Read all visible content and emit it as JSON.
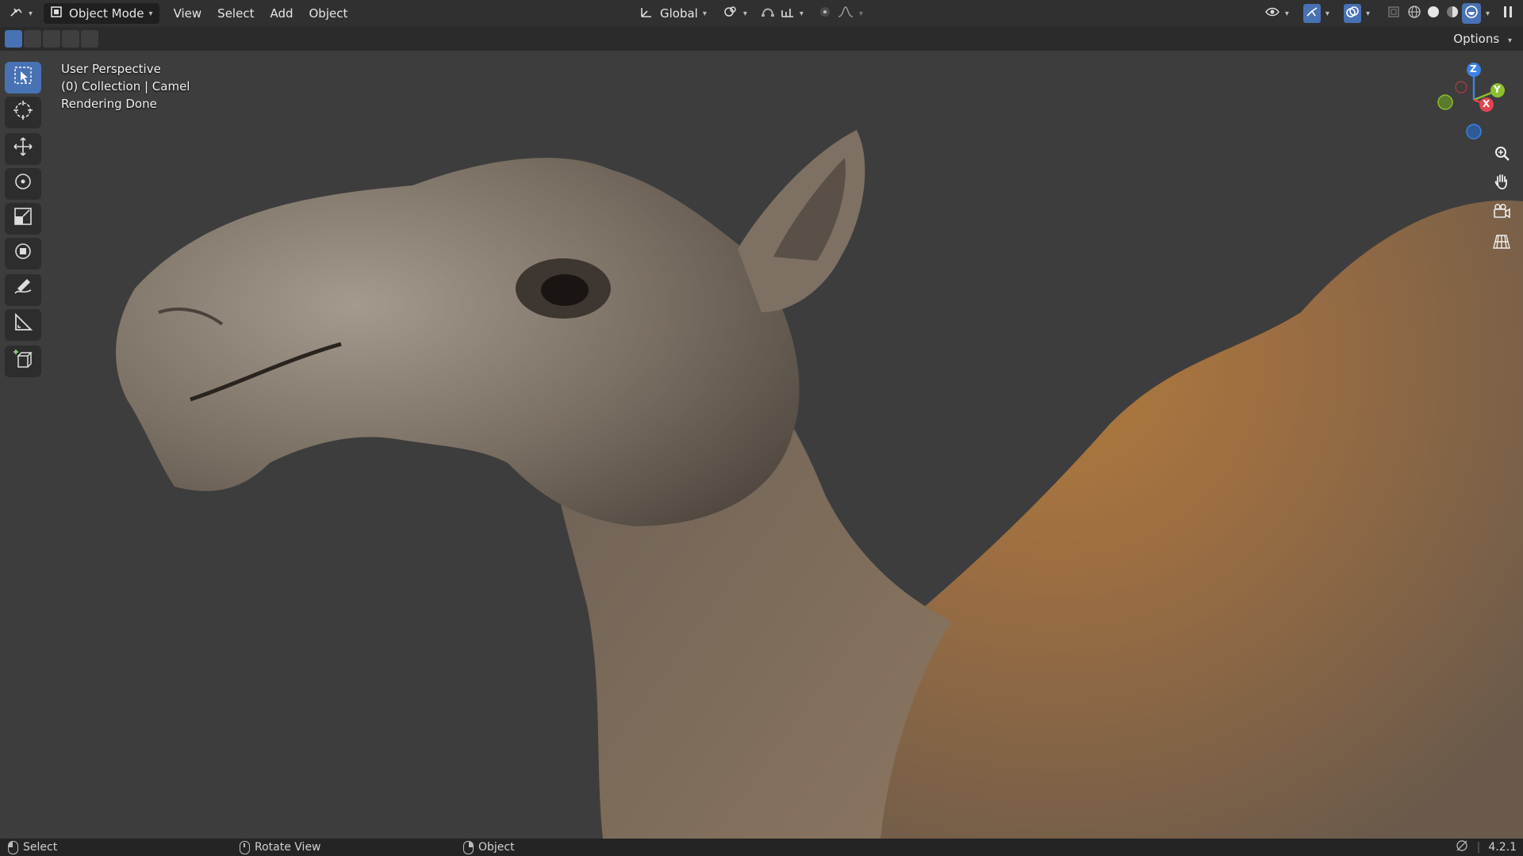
{
  "header": {
    "mode": "Object Mode",
    "menus": [
      "View",
      "Select",
      "Add",
      "Object"
    ],
    "transform_orientation": "Global"
  },
  "subheader": {
    "options_label": "Options"
  },
  "viewport": {
    "info_lines": [
      "User Perspective",
      "(0) Collection | Camel",
      "Rendering Done"
    ],
    "gizmo_axes": {
      "z": "Z",
      "x": "X",
      "y": "Y"
    }
  },
  "statusbar": {
    "left": "Select",
    "middle": "Rotate View",
    "right": "Object",
    "version": "4.2.1"
  },
  "colors": {
    "header_bg": "#303030",
    "viewport_bg": "#3d3d3d",
    "accent": "#4772b3",
    "axis_x": "#e4434f",
    "axis_y": "#8cbe2f",
    "axis_z": "#3b82e3"
  },
  "icons": [
    "editor-type-icon",
    "object-mode-icon",
    "transform-orientation-icon",
    "pivot-icon",
    "snap-icon",
    "proportional-icon",
    "visibility-icon",
    "gizmo-icon",
    "overlay-icon",
    "xray-icon",
    "wireframe-shading-icon",
    "solid-shading-icon",
    "material-shading-icon",
    "rendered-shading-icon",
    "select-box-icon",
    "cursor-icon",
    "move-icon",
    "rotate-icon",
    "scale-icon",
    "transform-icon",
    "annotate-icon",
    "measure-icon",
    "add-cube-icon",
    "zoom-icon",
    "pan-hand-icon",
    "camera-view-icon",
    "ortho-grid-icon"
  ]
}
